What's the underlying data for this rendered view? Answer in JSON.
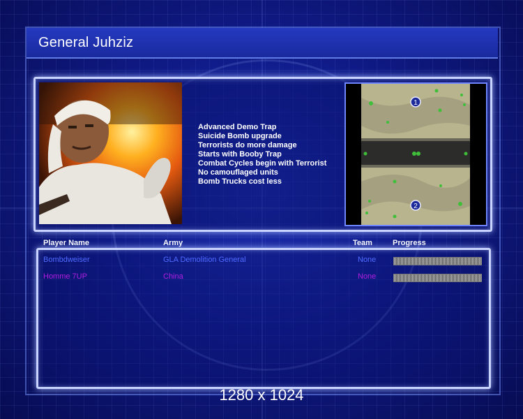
{
  "screen": {
    "title": "General Juhziz",
    "resolution_label": "1280 x 1024"
  },
  "general": {
    "portrait_icon": "general-portrait",
    "features": [
      "Advanced Demo Trap",
      "Suicide Bomb upgrade",
      "Terrorists do more damage",
      "Starts with Booby Trap",
      "Combat Cycles begin with Terrorist",
      "No camouflaged units",
      "Bomb Trucks cost less"
    ]
  },
  "map": {
    "icon": "map-preview",
    "start_positions": [
      "1",
      "2"
    ]
  },
  "players_table": {
    "headers": {
      "player_name": "Player Name",
      "army": "Army",
      "team": "Team",
      "progress": "Progress"
    },
    "rows": [
      {
        "name": "Bombdweiser",
        "army": "GLA Demolition General",
        "team": "None",
        "color": "#4f6cff"
      },
      {
        "name": "Homme 7UP",
        "army": "China",
        "team": "None",
        "color": "#b21ee0"
      }
    ]
  }
}
